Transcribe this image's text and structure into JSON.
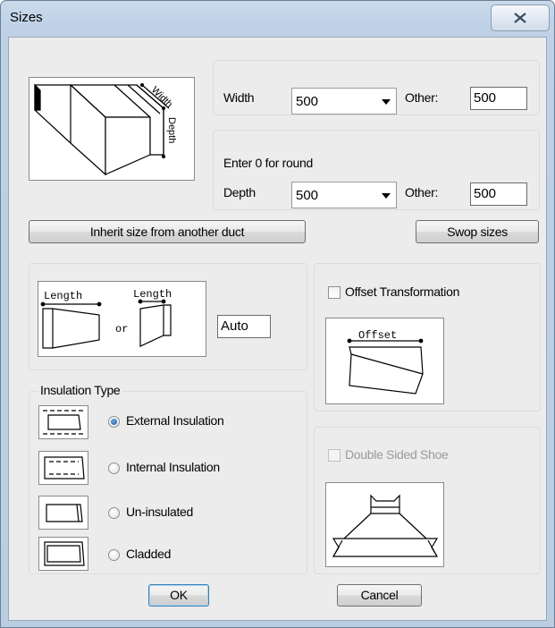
{
  "window": {
    "title": "Sizes"
  },
  "width": {
    "label": "Width",
    "selected": "500",
    "other_label": "Other:",
    "other_value": "500"
  },
  "depth": {
    "hint": "Enter 0 for round",
    "label": "Depth",
    "selected": "500",
    "other_label": "Other:",
    "other_value": "500"
  },
  "buttons": {
    "inherit": "Inherit size from another duct",
    "swop": "Swop sizes",
    "ok": "OK",
    "cancel": "Cancel"
  },
  "length": {
    "value": "Auto",
    "diagram_label": "Length",
    "or_text": "or"
  },
  "offset": {
    "checkbox_label": "Offset Transformation",
    "checked": false,
    "diagram_label": "Offset"
  },
  "insulation": {
    "group_label": "Insulation Type",
    "options": [
      {
        "label": "External Insulation",
        "selected": true
      },
      {
        "label": "Internal Insulation",
        "selected": false
      },
      {
        "label": "Un-insulated",
        "selected": false
      },
      {
        "label": "Cladded",
        "selected": false
      }
    ]
  },
  "shoe": {
    "checkbox_label": "Double Sided Shoe",
    "enabled": false,
    "checked": false
  },
  "duct_diagram": {
    "width_label": "Width",
    "depth_label": "Depth"
  }
}
